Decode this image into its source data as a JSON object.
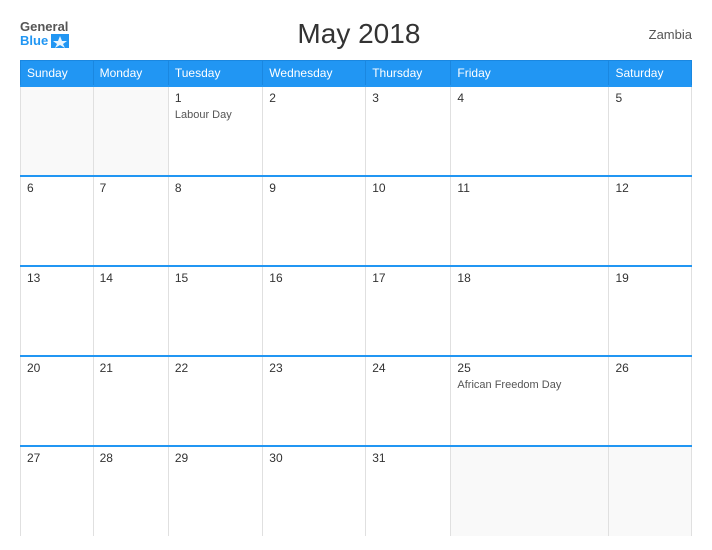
{
  "header": {
    "logo_general": "General",
    "logo_blue": "Blue",
    "title": "May 2018",
    "country": "Zambia"
  },
  "weekdays": [
    "Sunday",
    "Monday",
    "Tuesday",
    "Wednesday",
    "Thursday",
    "Friday",
    "Saturday"
  ],
  "weeks": [
    [
      {
        "day": "",
        "empty": true
      },
      {
        "day": "",
        "empty": true
      },
      {
        "day": "1",
        "event": "Labour Day"
      },
      {
        "day": "2",
        "event": ""
      },
      {
        "day": "3",
        "event": ""
      },
      {
        "day": "4",
        "event": ""
      },
      {
        "day": "5",
        "event": ""
      }
    ],
    [
      {
        "day": "6",
        "event": ""
      },
      {
        "day": "7",
        "event": ""
      },
      {
        "day": "8",
        "event": ""
      },
      {
        "day": "9",
        "event": ""
      },
      {
        "day": "10",
        "event": ""
      },
      {
        "day": "11",
        "event": ""
      },
      {
        "day": "12",
        "event": ""
      }
    ],
    [
      {
        "day": "13",
        "event": ""
      },
      {
        "day": "14",
        "event": ""
      },
      {
        "day": "15",
        "event": ""
      },
      {
        "day": "16",
        "event": ""
      },
      {
        "day": "17",
        "event": ""
      },
      {
        "day": "18",
        "event": ""
      },
      {
        "day": "19",
        "event": ""
      }
    ],
    [
      {
        "day": "20",
        "event": ""
      },
      {
        "day": "21",
        "event": ""
      },
      {
        "day": "22",
        "event": ""
      },
      {
        "day": "23",
        "event": ""
      },
      {
        "day": "24",
        "event": ""
      },
      {
        "day": "25",
        "event": "African Freedom Day"
      },
      {
        "day": "26",
        "event": ""
      }
    ],
    [
      {
        "day": "27",
        "event": ""
      },
      {
        "day": "28",
        "event": ""
      },
      {
        "day": "29",
        "event": ""
      },
      {
        "day": "30",
        "event": ""
      },
      {
        "day": "31",
        "event": ""
      },
      {
        "day": "",
        "empty": true
      },
      {
        "day": "",
        "empty": true
      }
    ]
  ]
}
